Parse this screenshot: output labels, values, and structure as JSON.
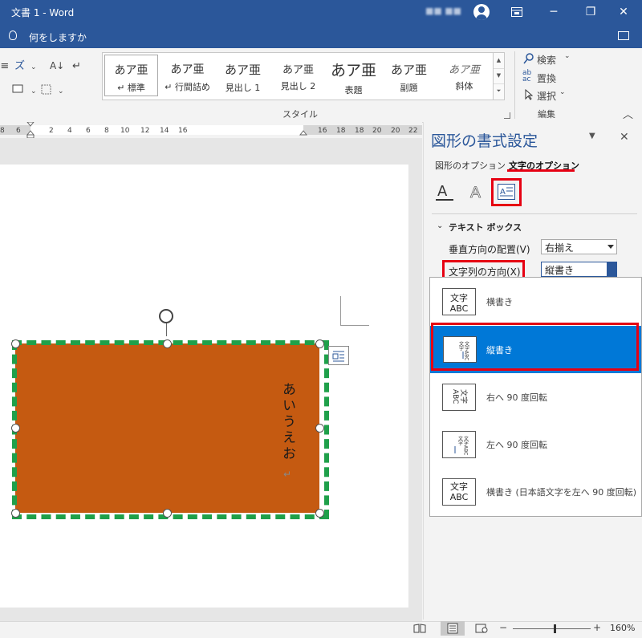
{
  "window": {
    "title": "文書 1  -  Word",
    "user_name": "■■ ■■",
    "buttons": {
      "ribbon_options": "ribbon-display-icon",
      "minimize": "─",
      "restore": "❐",
      "close": "✕"
    }
  },
  "tell_me": {
    "label": "何をしますか"
  },
  "ribbon": {
    "styles": [
      {
        "sample": "あア亜",
        "name": "↵ 標準"
      },
      {
        "sample": "あア亜",
        "name": "↵ 行間詰め"
      },
      {
        "sample": "あア亜",
        "name": "見出し 1"
      },
      {
        "sample": "あア亜",
        "name": "見出し 2"
      },
      {
        "sample": "あア亜",
        "name": "表題"
      },
      {
        "sample": "あア亜",
        "name": "副題"
      },
      {
        "sample": "あア亜",
        "name": "斜体"
      }
    ],
    "styles_group_label": "スタイル",
    "editing": {
      "find": "検索",
      "replace": "置換",
      "select": "選択",
      "group_label": "編集"
    }
  },
  "ruler": {
    "ticks": [
      "8",
      "6",
      "4",
      "2",
      "",
      "2",
      "4",
      "6",
      "8",
      "10",
      "12",
      "14",
      "16",
      "18",
      "20",
      "22"
    ]
  },
  "document": {
    "shape_text": "あいうえお",
    "paragraph_mark": "↵"
  },
  "pane": {
    "title": "図形の書式設定",
    "tabs": [
      "図形のオプション",
      "文字のオプション"
    ],
    "active_tab": "文字のオプション",
    "section": "テキスト ボックス",
    "fields": [
      {
        "label": "垂直方向の配置(V)",
        "value": "右揃え"
      },
      {
        "label": "文字列の方向(X)",
        "value": "縦書き"
      }
    ],
    "direction_options": [
      {
        "label": "横書き",
        "icon_text": "文字\nABC"
      },
      {
        "label": "縦書き",
        "icon_text": "文字ABC"
      },
      {
        "label": "右へ 90 度回転",
        "icon_text": "文字\nABC"
      },
      {
        "label": "左へ 90 度回転",
        "icon_text": "文字ABC"
      },
      {
        "label": "横書き (日本語文字を左へ 90 度回転)",
        "icon_text": "文字\nABC"
      }
    ],
    "selected_option_index": 1
  },
  "status": {
    "zoom": "160%",
    "zoom_minus": "−",
    "zoom_plus": "+"
  },
  "colors": {
    "accent": "#2b579a",
    "shape_fill": "#c55a11",
    "shape_border": "#1fa04a",
    "highlight": "#e60012",
    "selection": "#0078d7"
  }
}
